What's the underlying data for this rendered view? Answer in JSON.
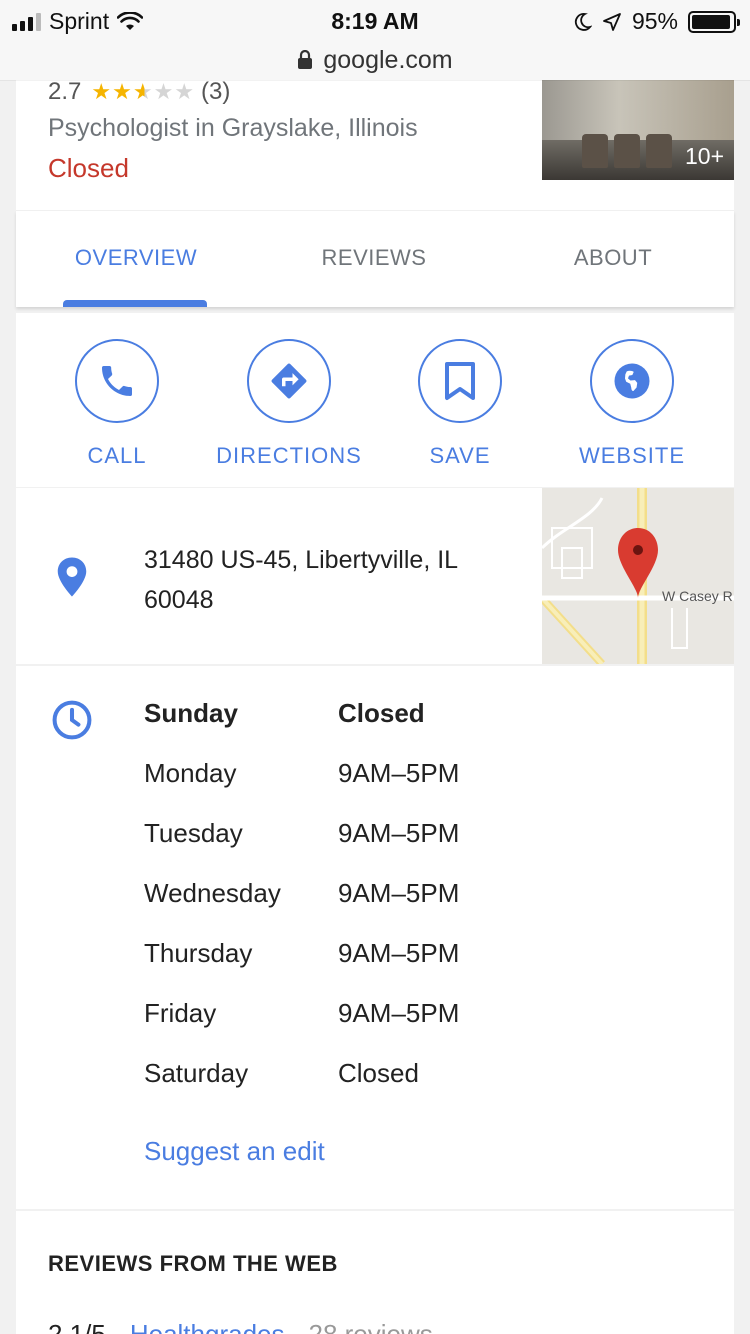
{
  "status_bar": {
    "carrier": "Sprint",
    "time": "8:19 AM",
    "battery_percent": "95%",
    "battery_level": 0.95
  },
  "url_bar": {
    "domain": "google.com"
  },
  "business": {
    "rating": "2.7",
    "stars": 2.7,
    "review_count": "(3)",
    "category": "Psychologist in Grayslake, Illinois",
    "open_status": "Closed",
    "photo_count": "10+"
  },
  "tabs": [
    {
      "label": "OVERVIEW",
      "active": true
    },
    {
      "label": "REVIEWS",
      "active": false
    },
    {
      "label": "ABOUT",
      "active": false
    }
  ],
  "actions": [
    {
      "label": "CALL",
      "icon": "phone-icon"
    },
    {
      "label": "DIRECTIONS",
      "icon": "directions-icon"
    },
    {
      "label": "SAVE",
      "icon": "bookmark-icon"
    },
    {
      "label": "WEBSITE",
      "icon": "globe-icon"
    }
  ],
  "address": {
    "line1": "31480 US-45, Libertyville, IL",
    "line2": "60048",
    "map_street_label": "W Casey R"
  },
  "hours": [
    {
      "day": "Sunday",
      "time": "Closed"
    },
    {
      "day": "Monday",
      "time": "9AM–5PM"
    },
    {
      "day": "Tuesday",
      "time": "9AM–5PM"
    },
    {
      "day": "Wednesday",
      "time": "9AM–5PM"
    },
    {
      "day": "Thursday",
      "time": "9AM–5PM"
    },
    {
      "day": "Friday",
      "time": "9AM–5PM"
    },
    {
      "day": "Saturday",
      "time": "Closed"
    }
  ],
  "suggest_edit": "Suggest an edit",
  "reviews_from_web": {
    "heading": "REVIEWS FROM THE WEB",
    "score": "2.1/5",
    "source": "Healthgrades",
    "count": "28 reviews"
  },
  "colors": {
    "accent": "#4a7de1",
    "closed": "#c5382b",
    "star": "#f5b400"
  }
}
